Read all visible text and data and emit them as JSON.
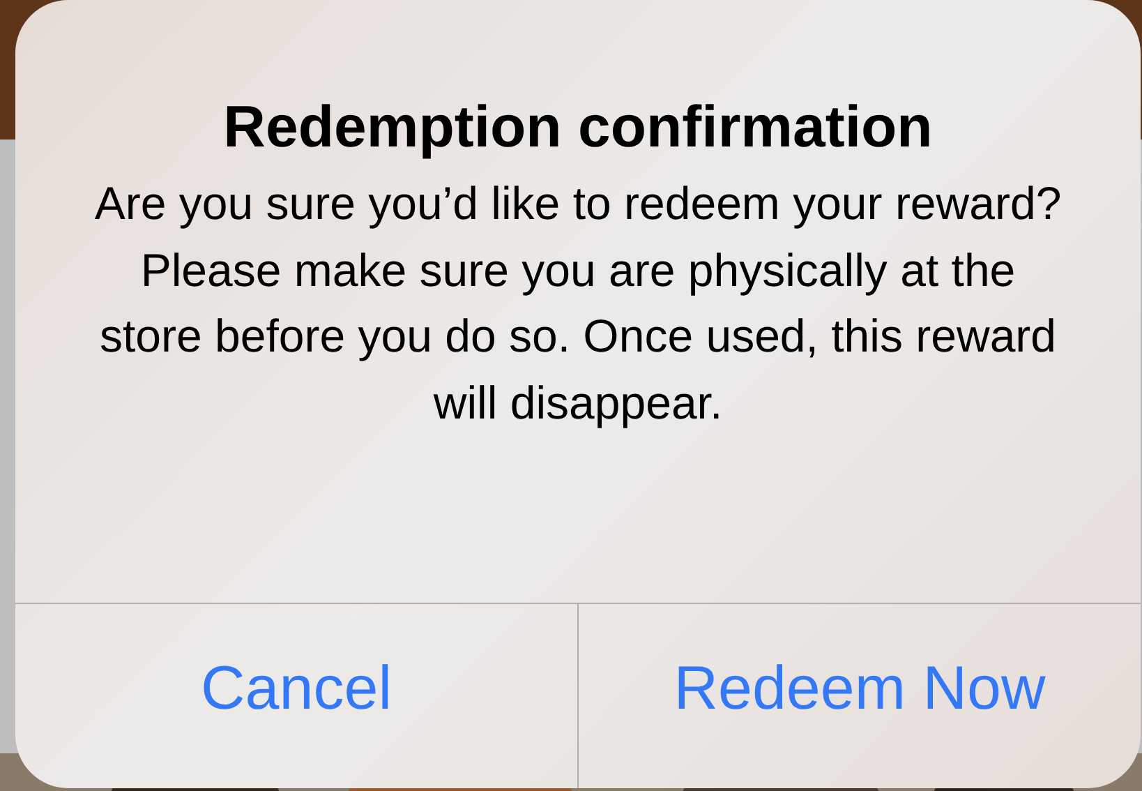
{
  "alert": {
    "title": "Redemption confirmation",
    "message": "Are you sure you’d like to redeem your reward? Please make sure you are physically at the store before you do so. Once used, this reward will disappear.",
    "buttons": [
      {
        "label": "Cancel"
      },
      {
        "label": "Redeem Now"
      }
    ]
  }
}
